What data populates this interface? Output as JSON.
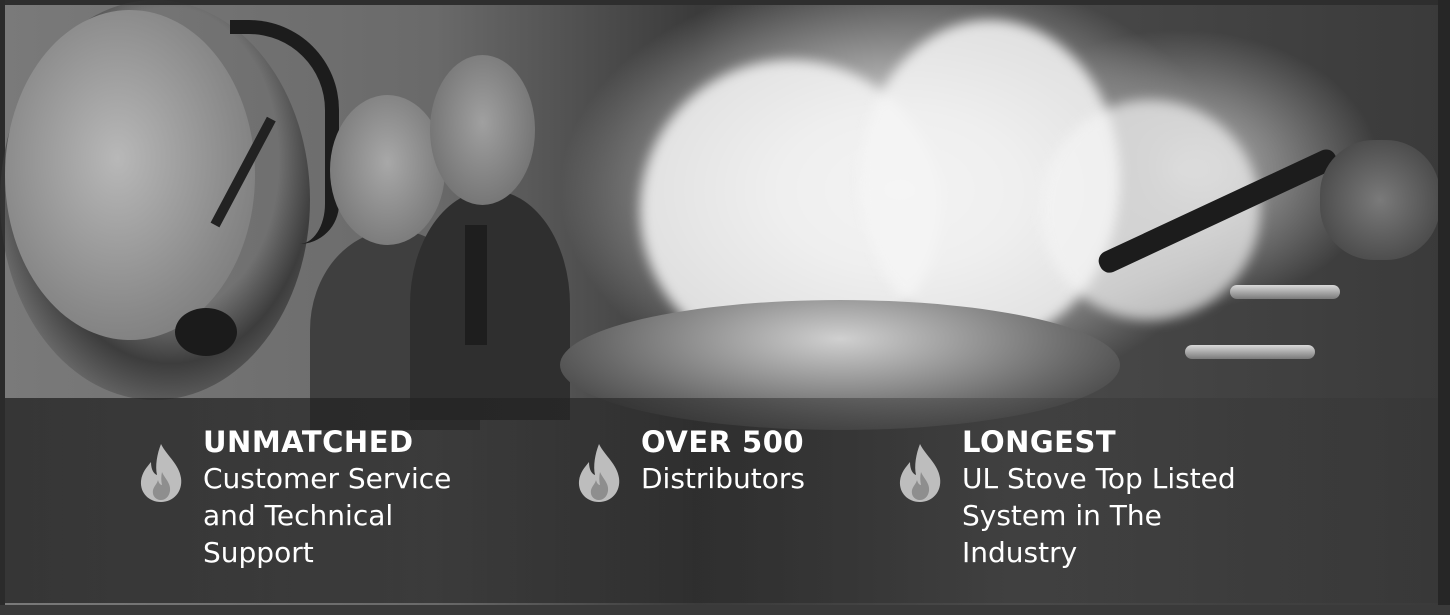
{
  "features": [
    {
      "heading": "UNMATCHED",
      "description": "Customer Service\nand Technical\nSupport",
      "icon": "flame-icon"
    },
    {
      "heading": "OVER 500",
      "description": "Distributors",
      "icon": "flame-icon"
    },
    {
      "heading": "LONGEST",
      "description": "UL Stove Top Listed\nSystem in The\nIndustry",
      "icon": "flame-icon"
    }
  ],
  "colors": {
    "text": "#ffffff",
    "icon": "#c8c8c8",
    "overlay": "#232323"
  }
}
